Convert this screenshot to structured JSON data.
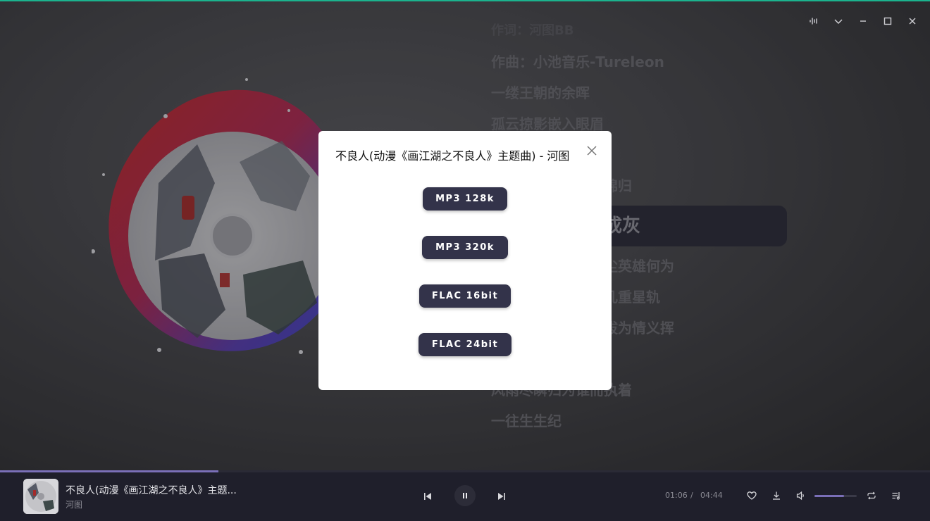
{
  "window": {
    "controls": [
      "waveform-icon",
      "collapse-icon",
      "minimize-icon",
      "maximize-icon",
      "close-icon"
    ]
  },
  "lyrics": {
    "lines": [
      {
        "text": "作词：河图BB",
        "style": "faded"
      },
      {
        "text": "作曲：小池音乐-Tureleon",
        "style": "normal"
      },
      {
        "text": "一缕王朝的余晖",
        "style": "normal"
      },
      {
        "text": "孤云掠影嵌入眼眉",
        "style": "normal"
      },
      {
        "text": "",
        "style": "normal"
      },
      {
        "text": "锦归",
        "style": "normal"
      },
      {
        "text": "成灰",
        "style": "active"
      },
      {
        "text": "尘英雄何为",
        "style": "normal"
      },
      {
        "text": "几重星轨",
        "style": "normal"
      },
      {
        "text": "拔为情义挥",
        "style": "normal"
      },
      {
        "text": "",
        "style": "normal"
      },
      {
        "text": "风雨尽瞬归为谁而执着",
        "style": "normal"
      },
      {
        "text": "一往生生纪",
        "style": "normal"
      }
    ]
  },
  "dialog": {
    "title": "不良人(动漫《画江湖之不良人》主题曲) - 河图",
    "options": [
      "MP3 128k",
      "MP3 320k",
      "FLAC 16bit",
      "FLAC 24bit"
    ]
  },
  "player": {
    "title": "不良人(动漫《画江湖之不良人》主题...",
    "artist": "河图",
    "current_time": "01:06",
    "separator": "/",
    "total_time": "04:44",
    "progress": 0.235,
    "volume": 0.7,
    "accent": "#7a6fb8",
    "controls": [
      "previous-icon",
      "pause-icon",
      "next-icon",
      "heart-icon",
      "download-icon",
      "volume-icon",
      "repeat-icon",
      "playlist-icon"
    ]
  }
}
